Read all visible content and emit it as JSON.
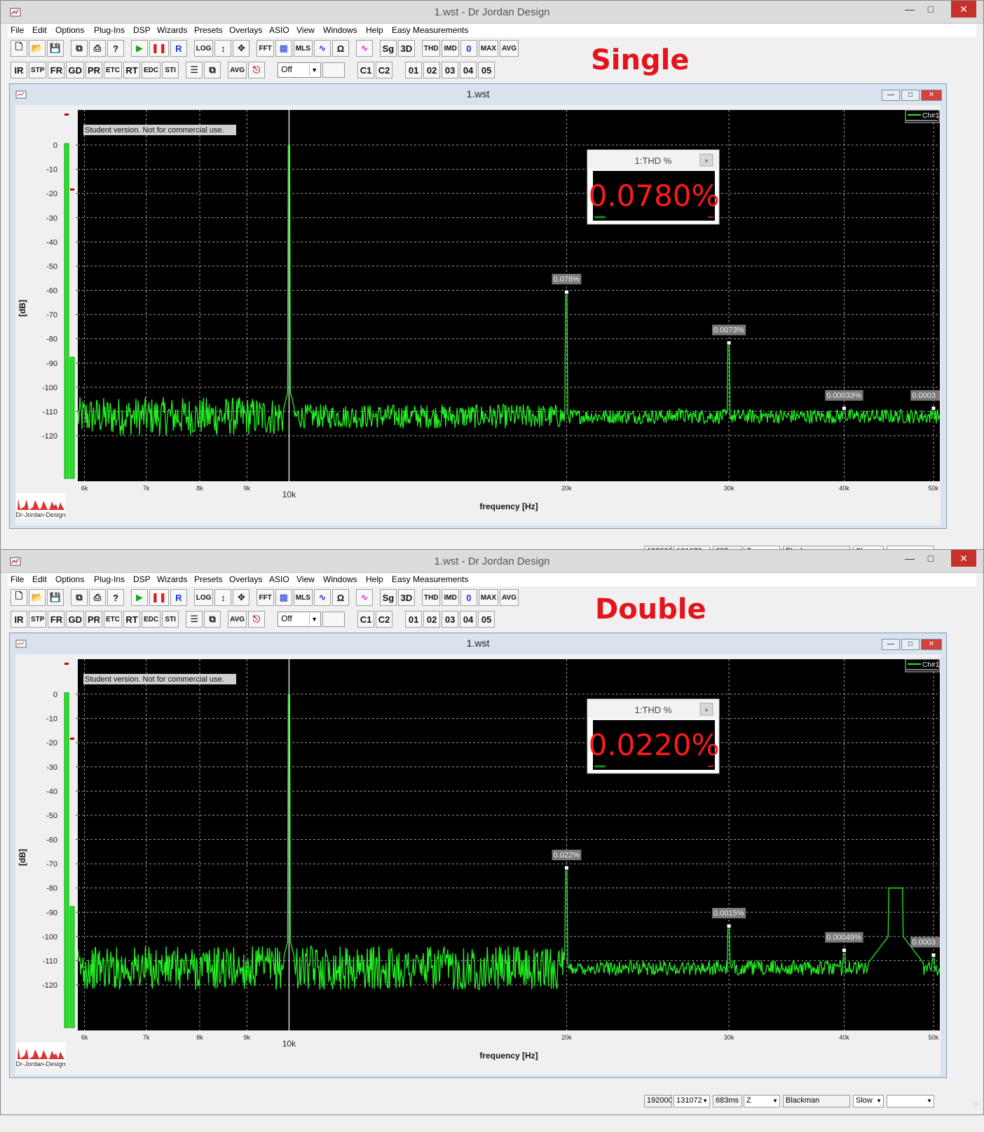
{
  "windows": [
    {
      "title": "1.wst - Dr Jordan Design",
      "banner": "Single",
      "child_title": "1.wst",
      "thd_title": "1:THD %",
      "thd_value": "0.0780%",
      "chart_data": {
        "type": "line",
        "xlabel": "frequency [Hz]",
        "ylabel": "[dB]",
        "x_scale": "log",
        "xlim": [
          5900,
          50800
        ],
        "ylim": [
          -129,
          0
        ],
        "x_ticks": [
          6000,
          7000,
          8000,
          9000,
          10000,
          20000,
          30000,
          40000,
          50000
        ],
        "x_tick_labels": [
          "6k",
          "7k",
          "8k",
          "9k",
          "10k",
          "20k",
          "30k",
          "40k",
          "50k"
        ],
        "y_ticks": [
          0,
          -10,
          -20,
          -30,
          -40,
          -50,
          -60,
          -70,
          -80,
          -90,
          -100,
          -110,
          -120
        ],
        "legend": "Ch#1",
        "legend_position": "top-right",
        "watermark": "Student version. Not for commercial use.",
        "noise_floor_db": -112,
        "peaks": [
          {
            "x": 10000,
            "y": 0
          },
          {
            "x": 20000,
            "y": -61,
            "label": "0.078%"
          },
          {
            "x": 26500,
            "y": -109
          },
          {
            "x": 30000,
            "y": -82,
            "label": "0.0073%"
          },
          {
            "x": 40000,
            "y": -109,
            "label": "0.00033%"
          },
          {
            "x": 50000,
            "y": -109,
            "label": "0.0003"
          }
        ],
        "series_color": "#22ee22"
      }
    },
    {
      "title": "1.wst - Dr Jordan Design",
      "banner": "Double",
      "child_title": "1.wst",
      "thd_title": "1:THD %",
      "thd_value": "0.0220%",
      "chart_data": {
        "type": "line",
        "xlabel": "frequency [Hz]",
        "ylabel": "[dB]",
        "x_scale": "log",
        "xlim": [
          5900,
          50800
        ],
        "ylim": [
          -129,
          0
        ],
        "x_ticks": [
          6000,
          7000,
          8000,
          9000,
          10000,
          20000,
          30000,
          40000,
          50000
        ],
        "x_tick_labels": [
          "6k",
          "7k",
          "8k",
          "9k",
          "10k",
          "20k",
          "30k",
          "40k",
          "50k"
        ],
        "y_ticks": [
          0,
          -10,
          -20,
          -30,
          -40,
          -50,
          -60,
          -70,
          -80,
          -90,
          -100,
          -110,
          -120
        ],
        "legend": "Ch#1",
        "legend_position": "top-right",
        "watermark": "Student version. Not for commercial use.",
        "noise_floor_db": -113,
        "peaks": [
          {
            "x": 10000,
            "y": 0
          },
          {
            "x": 20000,
            "y": -72,
            "label": "0.022%"
          },
          {
            "x": 30000,
            "y": -96,
            "label": "0.0015%"
          },
          {
            "x": 40000,
            "y": -106,
            "label": "0.00049%"
          },
          {
            "x": 45500,
            "y": -80
          },
          {
            "x": 50000,
            "y": -108,
            "label": "0.0003"
          }
        ],
        "series_color": "#22ee22"
      }
    }
  ],
  "menu": [
    "File",
    "Edit",
    "Options",
    "Plug-Ins",
    "DSP",
    "Wizards",
    "Presets",
    "Overlays",
    "ASIO",
    "View",
    "Windows",
    "Help",
    "Easy Measurements"
  ],
  "toolbar_row1": {
    "log": "LOG",
    "fft": "FFT",
    "mls": "MLS",
    "sg": "Sg",
    "3d": "3D",
    "thd": "THD",
    "imd": "IMD",
    "zero": "0",
    "max": "MAX",
    "avg": "AVG",
    "r": "R"
  },
  "toolbar_row2": {
    "ir": "IR",
    "stp": "STP",
    "fr": "FR",
    "gd": "GD",
    "pr": "PR",
    "etc": "ETC",
    "rt": "RT",
    "edc": "EDC",
    "sti": "STI",
    "avg": "AVG",
    "off_select": "Off",
    "c1": "C1",
    "c2": "C2",
    "n01": "01",
    "n02": "02",
    "n03": "03",
    "n04": "04",
    "n05": "05"
  },
  "status": {
    "rate": "192000",
    "fft_size": "131072",
    "time": "683ms",
    "z": "Z",
    "window": "Blackman",
    "speed": "Slow"
  },
  "logo_text": "Dr-Jordan-Design",
  "colors": {
    "banner": "#e3141c",
    "trace": "#22ee22",
    "thd_value": "#ff1a1a",
    "close": "#c7312b"
  }
}
